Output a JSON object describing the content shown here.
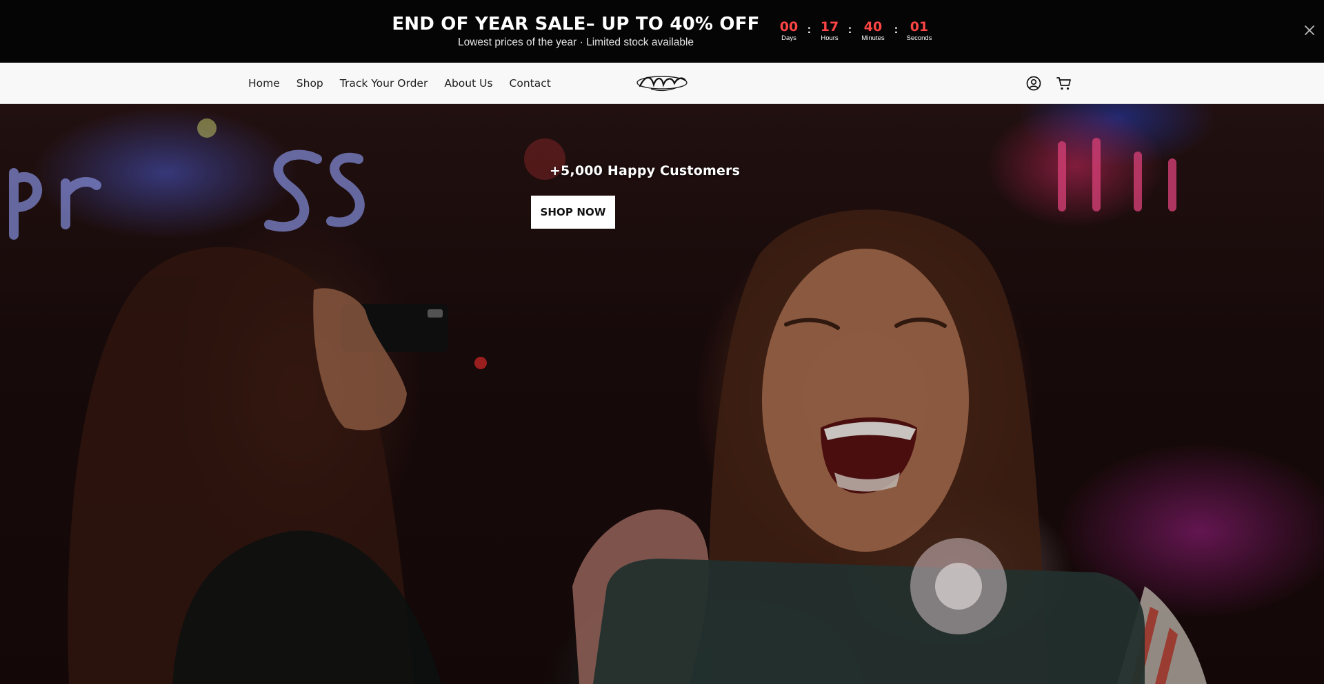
{
  "announcement": {
    "title": "END OF YEAR SALE– UP TO 40% OFF",
    "subtitle": "Lowest prices of the year · Limited stock available",
    "countdown": {
      "days": "00",
      "days_label": "Days",
      "hours": "17",
      "hours_label": "Hours",
      "minutes": "40",
      "minutes_label": "Minutes",
      "seconds": "01",
      "seconds_label": "Seconds",
      "separator": ":"
    },
    "close_icon": "close-icon"
  },
  "header": {
    "nav": [
      {
        "label": "Home"
      },
      {
        "label": "Shop"
      },
      {
        "label": "Track Your Order"
      },
      {
        "label": "About Us"
      },
      {
        "label": "Contact"
      }
    ],
    "logo_icon": "brand-logo",
    "account_icon": "account-icon",
    "cart_icon": "cart-icon"
  },
  "hero": {
    "heading": "+5,000 Happy Customers",
    "cta_label": "SHOP NOW"
  },
  "colors": {
    "announcement_bg": "#050505",
    "countdown_number": "#ff4545",
    "header_bg": "#f8f8f8",
    "button_bg": "#ffffff"
  }
}
